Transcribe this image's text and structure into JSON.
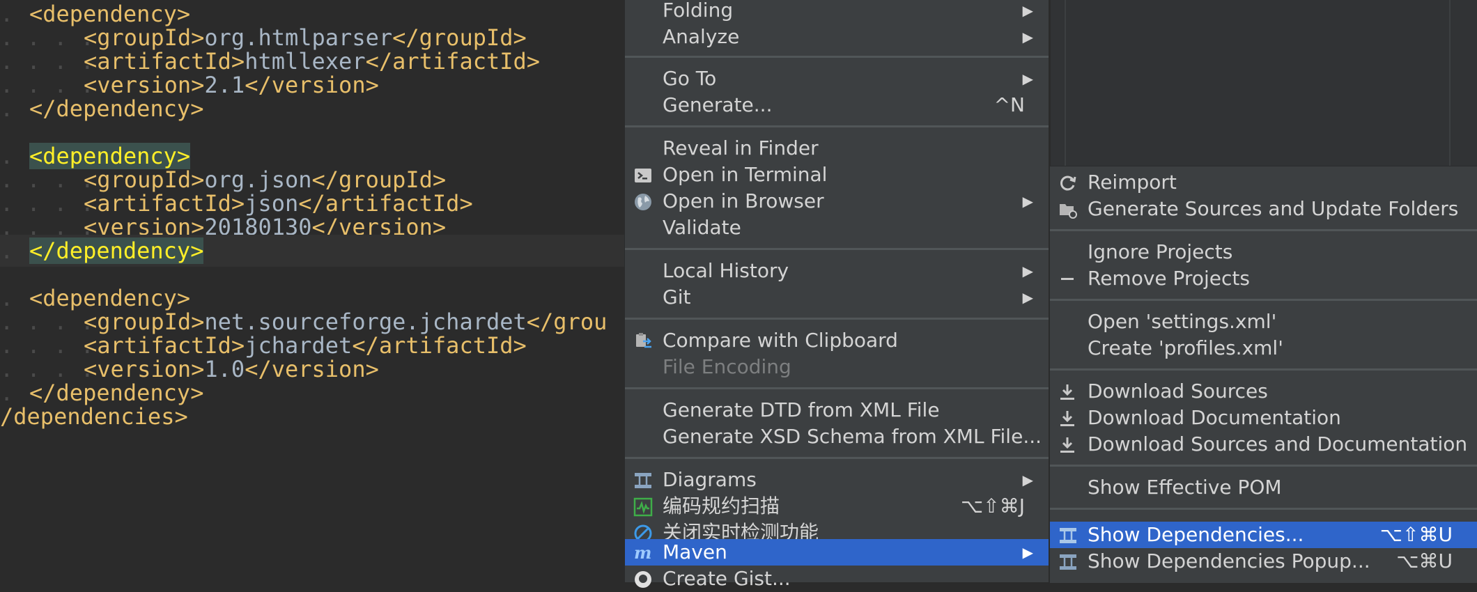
{
  "editor": {
    "lines": [
      {
        "indent": 1,
        "dots": ". ",
        "pre": "",
        "open": "<dependency>",
        "value": "",
        "close": ""
      },
      {
        "indent": 2,
        "dots": ". . . . ",
        "pre": "",
        "open": "<groupId>",
        "value": "org.htmlparser",
        "close": "</groupId>"
      },
      {
        "indent": 2,
        "dots": ". . . . ",
        "pre": "",
        "open": "<artifactId>",
        "value": "htmllexer",
        "close": "</artifactId>"
      },
      {
        "indent": 2,
        "dots": ". . . . ",
        "pre": "",
        "open": "<version>",
        "value": "2.1",
        "close": "</version>"
      },
      {
        "indent": 1,
        "dots": ". ",
        "pre": "",
        "open": "</dependency>",
        "value": "",
        "close": ""
      },
      {
        "indent": 0,
        "dots": "",
        "pre": "",
        "open": "",
        "value": "",
        "close": ""
      },
      {
        "indent": 1,
        "dots": ". ",
        "pre": "",
        "open": "<dependency>",
        "value": "",
        "close": "",
        "highlight": true
      },
      {
        "indent": 2,
        "dots": ". . . . ",
        "pre": "",
        "open": "<groupId>",
        "value": "org.json",
        "close": "</groupId>"
      },
      {
        "indent": 2,
        "dots": ". . . . ",
        "pre": "",
        "open": "<artifactId>",
        "value": "json",
        "close": "</artifactId>"
      },
      {
        "indent": 2,
        "dots": ". . . . ",
        "pre": "",
        "open": "<version>",
        "value": "20180130",
        "close": "</version>"
      },
      {
        "indent": 1,
        "dots": ". ",
        "pre": "",
        "open": "</dependency>",
        "value": "",
        "close": "",
        "highlight": true,
        "current": true
      },
      {
        "indent": 0,
        "dots": "",
        "pre": "",
        "open": "",
        "value": "",
        "close": ""
      },
      {
        "indent": 1,
        "dots": ". ",
        "pre": "",
        "open": "<dependency>",
        "value": "",
        "close": ""
      },
      {
        "indent": 2,
        "dots": ". . . . ",
        "pre": "",
        "open": "<groupId>",
        "value": "net.sourceforge.jchardet",
        "close": "</grou"
      },
      {
        "indent": 2,
        "dots": ". . . . ",
        "pre": "",
        "open": "<artifactId>",
        "value": "jchardet",
        "close": "</artifactId>"
      },
      {
        "indent": 2,
        "dots": ". . . . ",
        "pre": "",
        "open": "<version>",
        "value": "1.0",
        "close": "</version>"
      },
      {
        "indent": 1,
        "dots": ". ",
        "pre": "",
        "open": "</dependency>",
        "value": "",
        "close": ""
      },
      {
        "indent": 0,
        "dots": "",
        "pre": "",
        "open": "/dependencies>",
        "value": "",
        "close": ""
      }
    ]
  },
  "context_menu": {
    "items": [
      {
        "label": "Folding",
        "arrow": true
      },
      {
        "label": "Analyze",
        "arrow": true
      },
      {
        "label": "Go To",
        "arrow": true
      },
      {
        "label": "Generate...",
        "shortcut": "^N"
      },
      {
        "label": "Reveal in Finder"
      },
      {
        "label": "Open in Terminal",
        "icon": "terminal-icon"
      },
      {
        "label": "Open in Browser",
        "icon": "globe-icon",
        "arrow": true
      },
      {
        "label": "Validate"
      },
      {
        "label": "Local History",
        "arrow": true
      },
      {
        "label": "Git",
        "arrow": true
      },
      {
        "label": "Compare with Clipboard",
        "icon": "compare-clipboard-icon"
      },
      {
        "label": "File Encoding",
        "disabled": true
      },
      {
        "label": "Generate DTD from XML File"
      },
      {
        "label": "Generate XSD Schema from XML File..."
      },
      {
        "label": "Diagrams",
        "icon": "diagram-icon",
        "arrow": true
      },
      {
        "label": "编码规约扫描",
        "icon": "scan-icon",
        "shortcut": "⌥⇧⌘J"
      },
      {
        "label": "关闭实时检测功能",
        "icon": "disable-icon"
      },
      {
        "label": "Maven",
        "icon": "maven-icon",
        "arrow": true,
        "selected": true
      },
      {
        "label": "Create Gist...",
        "icon": "github-icon"
      }
    ],
    "arrow_glyph": "▶"
  },
  "maven_submenu": {
    "items": [
      {
        "label": "Reimport",
        "icon": "reimport-icon"
      },
      {
        "label": "Generate Sources and Update Folders",
        "icon": "generate-folders-icon"
      },
      {
        "label": "Ignore Projects"
      },
      {
        "label": "Remove Projects",
        "icon": "minus-icon"
      },
      {
        "label": "Open 'settings.xml'"
      },
      {
        "label": "Create 'profiles.xml'"
      },
      {
        "label": "Download Sources",
        "icon": "download-icon"
      },
      {
        "label": "Download Documentation",
        "icon": "download-icon"
      },
      {
        "label": "Download Sources and Documentation",
        "icon": "download-icon"
      },
      {
        "label": "Show Effective POM"
      },
      {
        "label": "Show Dependencies...",
        "icon": "dependencies-icon",
        "shortcut": "⌥⇧⌘U",
        "selected": true
      },
      {
        "label": "Show Dependencies Popup...",
        "icon": "dependencies-icon",
        "shortcut": "⌥⌘U"
      }
    ]
  },
  "colors": {
    "editor_bg": "#2b2b2b",
    "tag": "#e8bf6a",
    "text": "#a9b7c6",
    "menu_bg": "#3c3f41",
    "selection": "#2f65ca",
    "tag_highlight_bg": "#3b514d",
    "tag_highlight_fg": "#ffef28"
  }
}
